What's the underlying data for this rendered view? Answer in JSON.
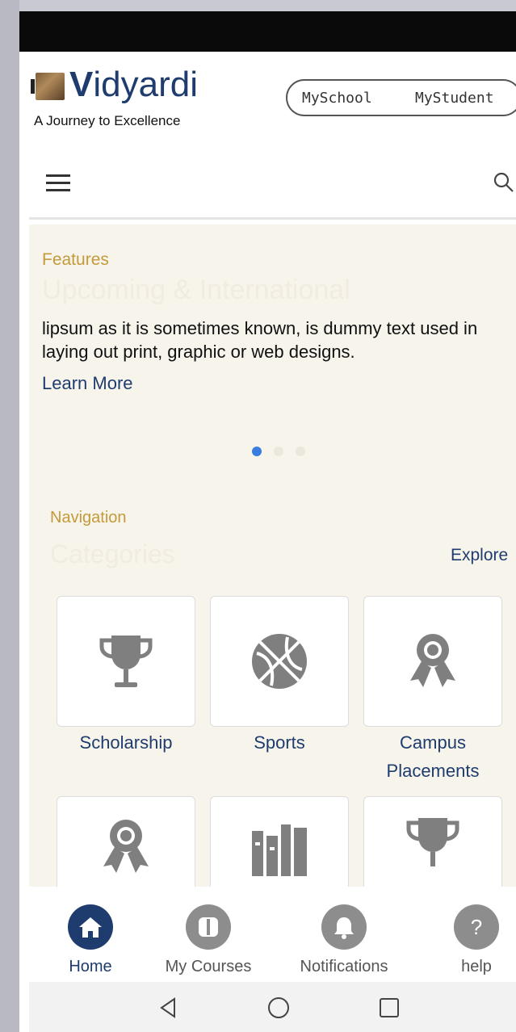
{
  "header": {
    "brand_first_letter": "V",
    "brand_rest": "idyardi",
    "tagline": "A Journey to Excellence",
    "links": [
      "MySchool",
      "MyStudent"
    ],
    "menu_icon": "hamburger-menu-icon",
    "search_icon": "search-icon"
  },
  "features": {
    "label": "Features",
    "heading_faded": "Upcoming & International",
    "text": "lipsum as it is sometimes known, is dummy text used in laying out print, graphic or web designs.",
    "link": "Learn More",
    "carousel_active_index": 0,
    "carousel_count": 3
  },
  "navigation": {
    "label": "Navigation",
    "heading_faded": "Categories",
    "explore": "Explore",
    "cards": [
      {
        "label": "Scholarship",
        "icon": "trophy-icon"
      },
      {
        "label": "Sports",
        "icon": "basketball-icon"
      },
      {
        "label": "Campus Placements",
        "icon": "award-ribbon-icon"
      },
      {
        "label": "",
        "icon": "award-ribbon-icon"
      },
      {
        "label": "",
        "icon": "books-icon"
      },
      {
        "label": "",
        "icon": "trophy-icon"
      }
    ]
  },
  "bottom_nav": [
    {
      "label": "Home",
      "icon": "home-icon",
      "active": true
    },
    {
      "label": "My Courses",
      "icon": "courses-icon",
      "active": false
    },
    {
      "label": "Notifications",
      "icon": "bell-icon",
      "active": false
    },
    {
      "label": "help",
      "icon": "help-icon",
      "active": false
    }
  ],
  "colors": {
    "brand": "#1f3c6e",
    "accent": "#c49a3a",
    "content_bg": "#f7f4ec",
    "carousel_active": "#3a7de0"
  }
}
